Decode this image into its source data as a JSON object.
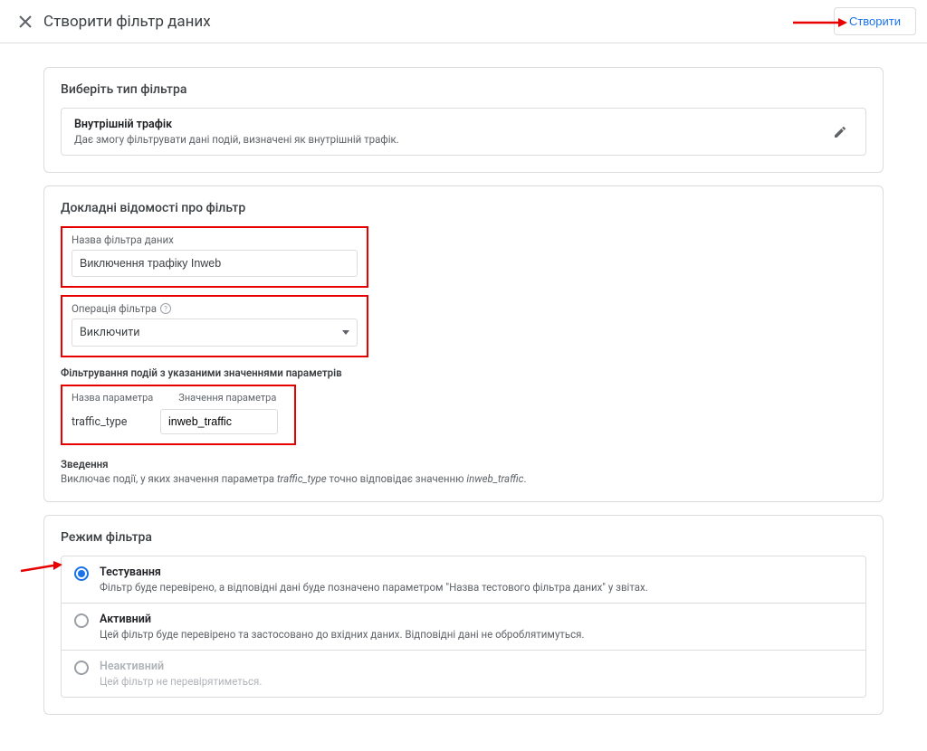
{
  "topbar": {
    "title": "Створити фільтр даних",
    "create_button": "Створити"
  },
  "card_type": {
    "title": "Виберіть тип фільтра",
    "option_title": "Внутрішній трафік",
    "option_desc": "Дає змогу фільтрувати дані подій, визначені як внутрішній трафік."
  },
  "card_details": {
    "title": "Докладні відомості про фільтр",
    "name_label": "Назва фільтра даних",
    "name_value": "Виключення трафіку Inweb",
    "operation_label": "Операція фільтра",
    "operation_value": "Виключити",
    "param_section_title": "Фільтрування подій з указаними значеннями параметрів",
    "param_name_header": "Назва параметра",
    "param_value_header": "Значення параметра",
    "param_name": "traffic_type",
    "param_value": "inweb_traffic",
    "summary_title": "Зведення",
    "summary_prefix": "Виключає події, у яких значення параметра ",
    "summary_param": "traffic_type",
    "summary_middle": " точно відповідає значенню ",
    "summary_value": "inweb_traffic",
    "summary_suffix": "."
  },
  "card_mode": {
    "title": "Режим фільтра",
    "modes": [
      {
        "title": "Тестування",
        "desc": "Фільтр буде перевірено, а відповідні дані буде позначено параметром \"Назва тестового фільтра даних\" у звітах.",
        "checked": true,
        "disabled": false
      },
      {
        "title": "Активний",
        "desc": "Цей фільтр буде перевірено та застосовано до вхідних даних. Відповідні дані не оброблятимуться.",
        "checked": false,
        "disabled": false
      },
      {
        "title": "Неактивний",
        "desc": "Цей фільтр не перевірятиметься.",
        "checked": false,
        "disabled": true
      }
    ]
  },
  "colors": {
    "annotation": "#e80000"
  }
}
